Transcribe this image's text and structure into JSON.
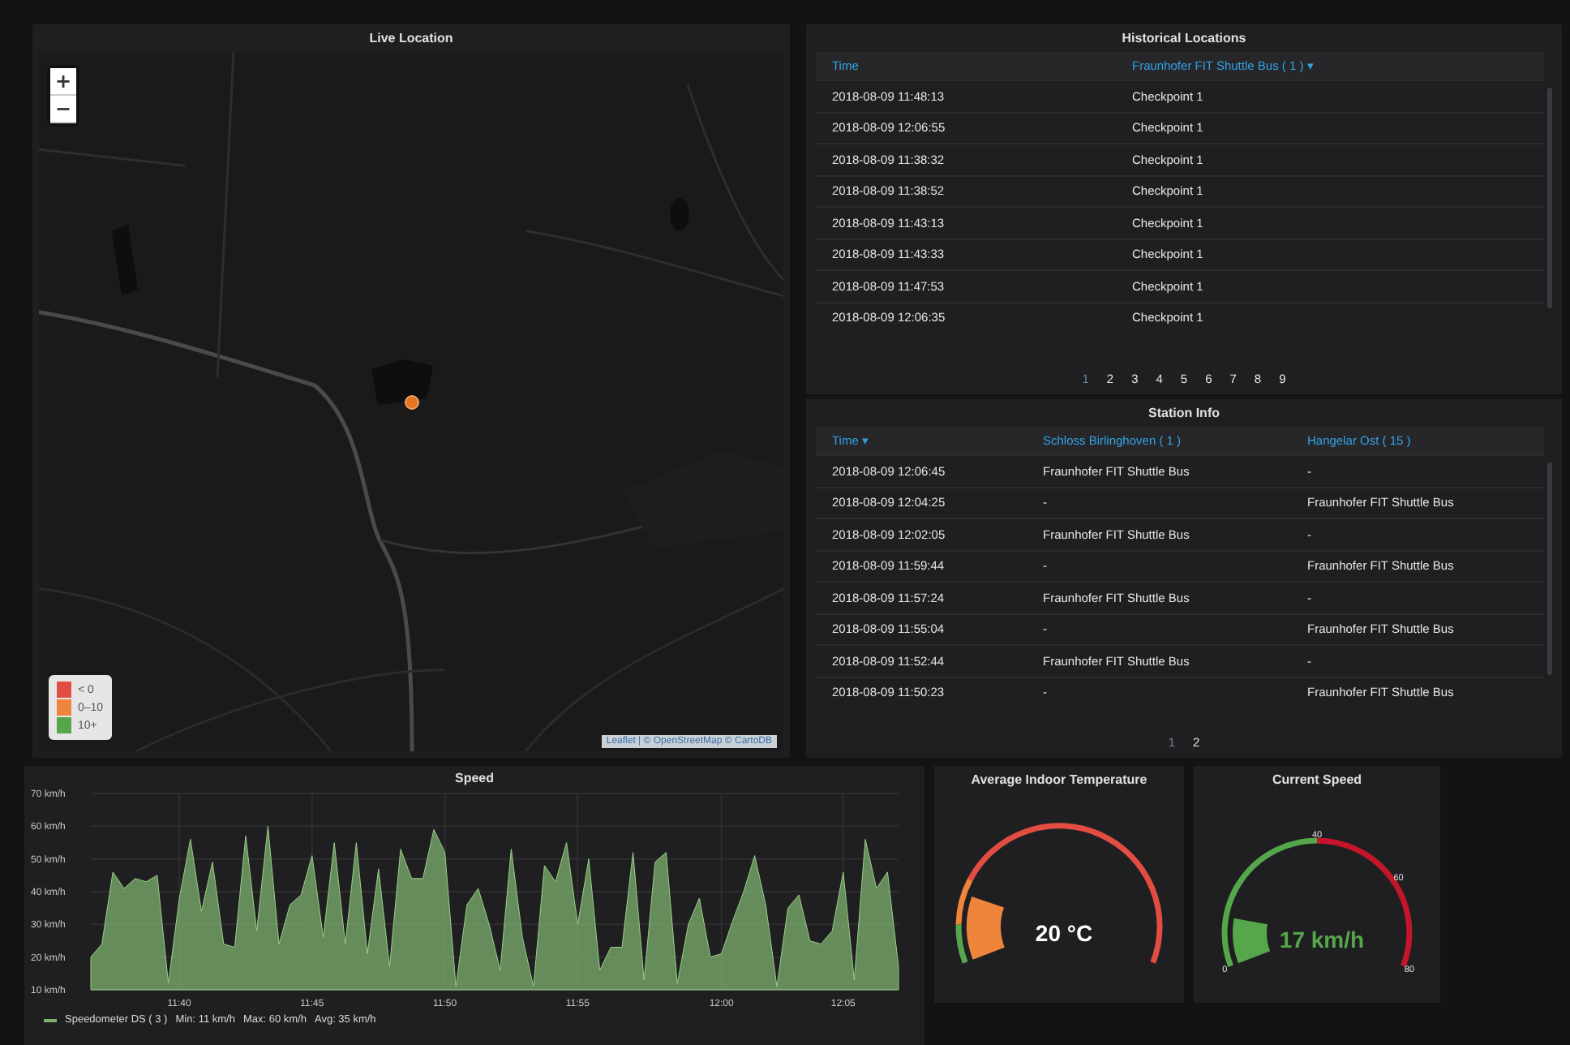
{
  "map_panel": {
    "title": "Live Location",
    "zoom_buttons": [
      "+",
      "−"
    ],
    "legend": [
      {
        "label": "< 0",
        "color": "#e24d42"
      },
      {
        "label": "0–10",
        "color": "#ef843c"
      },
      {
        "label": "10+",
        "color": "#56a64b"
      }
    ],
    "attribution": "Leaflet | © OpenStreetMap © CartoDB"
  },
  "historical_locations": {
    "title": "Historical Locations",
    "columns": [
      "Time",
      "Fraunhofer FIT Shuttle Bus ( 1 ) ▾"
    ],
    "rows": [
      [
        "2018-08-09 11:48:13",
        "Checkpoint 1"
      ],
      [
        "2018-08-09 12:06:55",
        "Checkpoint 1"
      ],
      [
        "2018-08-09 11:38:32",
        "Checkpoint 1"
      ],
      [
        "2018-08-09 11:38:52",
        "Checkpoint 1"
      ],
      [
        "2018-08-09 11:43:13",
        "Checkpoint 1"
      ],
      [
        "2018-08-09 11:43:33",
        "Checkpoint 1"
      ],
      [
        "2018-08-09 11:47:53",
        "Checkpoint 1"
      ],
      [
        "2018-08-09 12:06:35",
        "Checkpoint 1"
      ]
    ],
    "pages": [
      {
        "label": "1",
        "selected": true
      },
      {
        "label": "2",
        "selected": false
      },
      {
        "label": "3",
        "selected": false
      },
      {
        "label": "4",
        "selected": false
      },
      {
        "label": "5",
        "selected": false
      },
      {
        "label": "6",
        "selected": false
      },
      {
        "label": "7",
        "selected": false
      },
      {
        "label": "8",
        "selected": false
      },
      {
        "label": "9",
        "selected": false
      }
    ]
  },
  "station_info": {
    "title": "Station Info",
    "columns": [
      "Time ▾",
      "Schloss Birlinghoven ( 1 )",
      "Hangelar Ost ( 15 )"
    ],
    "rows": [
      [
        "2018-08-09 12:06:45",
        "Fraunhofer FIT Shuttle Bus",
        "-"
      ],
      [
        "2018-08-09 12:04:25",
        "-",
        "Fraunhofer FIT Shuttle Bus"
      ],
      [
        "2018-08-09 12:02:05",
        "Fraunhofer FIT Shuttle Bus",
        "-"
      ],
      [
        "2018-08-09 11:59:44",
        "-",
        "Fraunhofer FIT Shuttle Bus"
      ],
      [
        "2018-08-09 11:57:24",
        "Fraunhofer FIT Shuttle Bus",
        "-"
      ],
      [
        "2018-08-09 11:55:04",
        "-",
        "Fraunhofer FIT Shuttle Bus"
      ],
      [
        "2018-08-09 11:52:44",
        "Fraunhofer FIT Shuttle Bus",
        "-"
      ],
      [
        "2018-08-09 11:50:23",
        "-",
        "Fraunhofer FIT Shuttle Bus"
      ]
    ],
    "pages": [
      {
        "label": "1",
        "selected": true
      },
      {
        "label": "2",
        "selected": false
      }
    ]
  },
  "speed_panel": {
    "title": "Speed",
    "legend": {
      "stats": [
        "Min: 11 km/h",
        "Max: 60 km/h",
        "Avg: 35 km/h"
      ]
    },
    "chart_data": {
      "type": "area",
      "grid": true,
      "ylim": [
        10,
        70
      ],
      "yticks": [
        {
          "value": 10,
          "label": "10 km/h"
        },
        {
          "value": 20,
          "label": "20 km/h"
        },
        {
          "value": 30,
          "label": "30 km/h"
        },
        {
          "value": 40,
          "label": "40 km/h"
        },
        {
          "value": 50,
          "label": "50 km/h"
        },
        {
          "value": 60,
          "label": "60 km/h"
        },
        {
          "value": 70,
          "label": "70 km/h"
        }
      ],
      "categories": [
        null,
        null,
        null,
        null,
        null,
        null,
        null,
        null,
        "11:40",
        null,
        null,
        null,
        null,
        null,
        null,
        null,
        null,
        null,
        null,
        null,
        "11:45",
        null,
        null,
        null,
        null,
        null,
        null,
        null,
        null,
        null,
        null,
        null,
        "11:50",
        null,
        null,
        null,
        null,
        null,
        null,
        null,
        null,
        null,
        null,
        null,
        "11:55",
        null,
        null,
        null,
        null,
        null,
        null,
        null,
        null,
        null,
        null,
        null,
        null,
        "12:00",
        null,
        null,
        null,
        null,
        null,
        null,
        null,
        null,
        null,
        null,
        "12:05",
        null,
        null,
        null,
        null,
        null
      ],
      "series": [
        {
          "name": "Speedometer DS ( 3 )",
          "color": "#7eb26d",
          "values": [
            20,
            24,
            46,
            41,
            44,
            43,
            45,
            12,
            38,
            56,
            34,
            49,
            24,
            23,
            57,
            28,
            60,
            24,
            36,
            39,
            51,
            26,
            55,
            24,
            55,
            21,
            47,
            17,
            53,
            44,
            44,
            59,
            52,
            11,
            36,
            41,
            30,
            16,
            53,
            26,
            11,
            48,
            43,
            55,
            30,
            50,
            16,
            23,
            23,
            52,
            13,
            49,
            52,
            12,
            30,
            38,
            20,
            21,
            31,
            40,
            51,
            36,
            11,
            35,
            39,
            25,
            24,
            28,
            46,
            13,
            56,
            41,
            46,
            17
          ]
        }
      ]
    }
  },
  "gauges": [
    {
      "title": "Average Indoor Temperature",
      "value": "20 °C"
    },
    {
      "title": "Current Speed",
      "value": "17 km/h",
      "ticks": [
        "0",
        "40",
        "60",
        "80"
      ]
    }
  ]
}
